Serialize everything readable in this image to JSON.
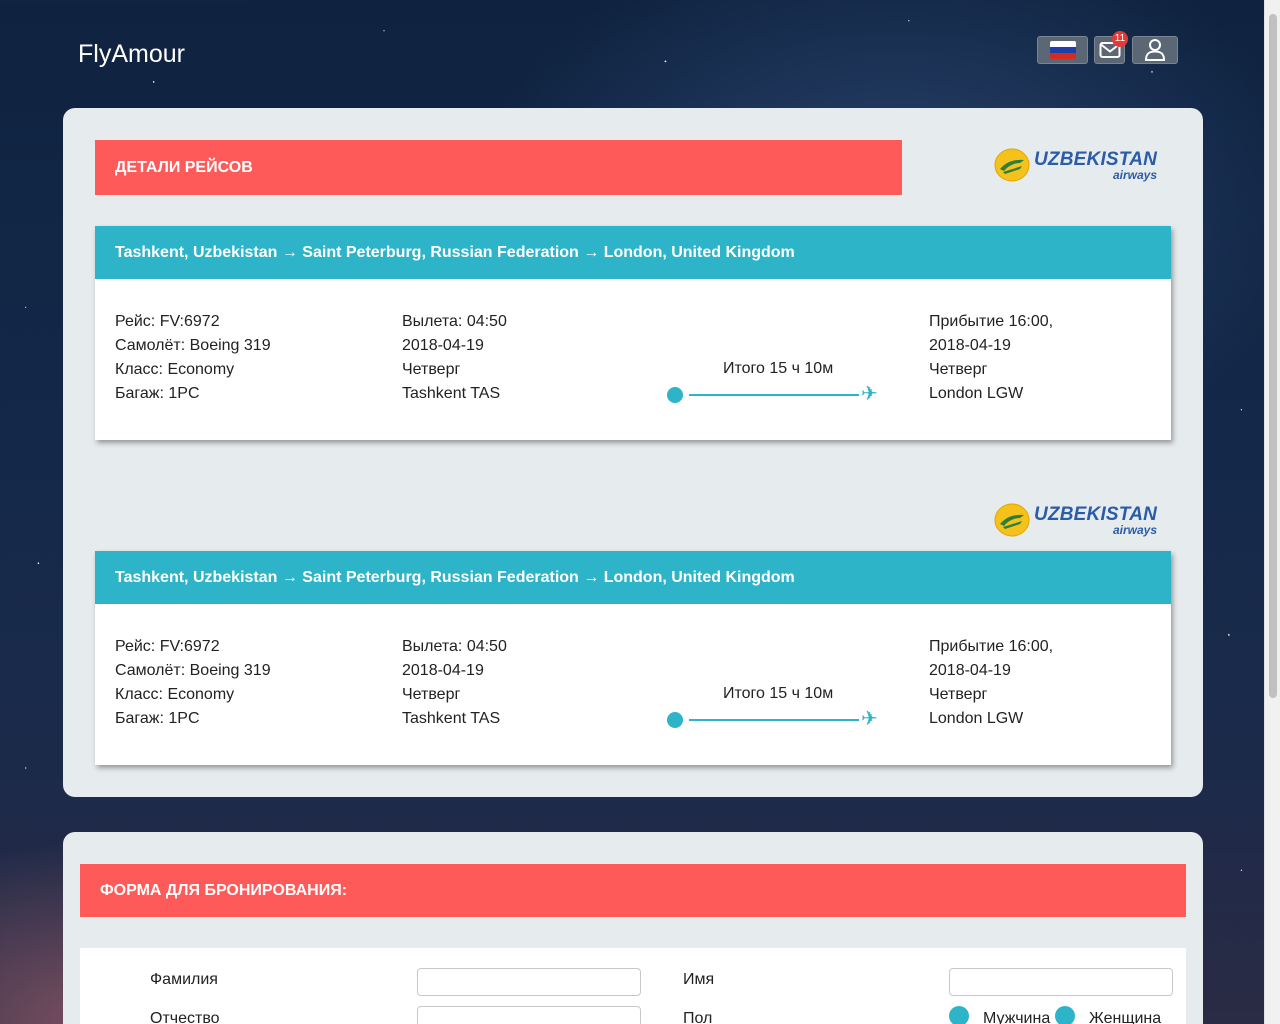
{
  "app": {
    "name": "FlyAmour"
  },
  "header": {
    "language_flag": "ru",
    "mail_badge": "11"
  },
  "flights_section": {
    "title": "ДЕТАЛИ РЕЙСОВ",
    "airline": {
      "name_line1": "UZBEKISTAN",
      "name_line2": "airways"
    },
    "cards": [
      {
        "route": "Tashkent, Uzbekistan → Saint Peterburg, Russian Federation → London, United Kingdom",
        "info": [
          "Рейс: FV:6972",
          "Самолёт: Boeing 319",
          "Класс: Economy",
          "Багаж: 1PC"
        ],
        "departure": [
          "Вылета: 04:50",
          "2018-04-19",
          "Четверг",
          "Tashkent TAS"
        ],
        "duration": "Итого 15 ч 10м",
        "arrival": [
          "Прибытие 16:00,",
          "2018-04-19",
          "Четверг",
          "London LGW"
        ]
      },
      {
        "route": "Tashkent, Uzbekistan → Saint Peterburg, Russian Federation → London, United Kingdom",
        "info": [
          "Рейс: FV:6972",
          "Самолёт: Boeing 319",
          "Класс: Economy",
          "Багаж: 1PC"
        ],
        "departure": [
          "Вылета: 04:50",
          "2018-04-19",
          "Четверг",
          "Tashkent TAS"
        ],
        "duration": "Итого 15 ч 10м",
        "arrival": [
          "Прибытие 16:00,",
          "2018-04-19",
          "Четверг",
          "London LGW"
        ]
      }
    ]
  },
  "booking_form": {
    "title": "ФОРМА ДЛЯ БРОНИРОВАНИЯ:",
    "fields": {
      "surname_label": "Фамилия",
      "name_label": "Имя",
      "patronymic_label": "Отчество",
      "gender_label": "Пол",
      "male_label": "Мужчина",
      "female_label": "Женщина"
    }
  },
  "colors": {
    "accent_red": "#ff5a5a",
    "accent_teal": "#2eb4c8",
    "panel_bg": "#e6ebee"
  }
}
